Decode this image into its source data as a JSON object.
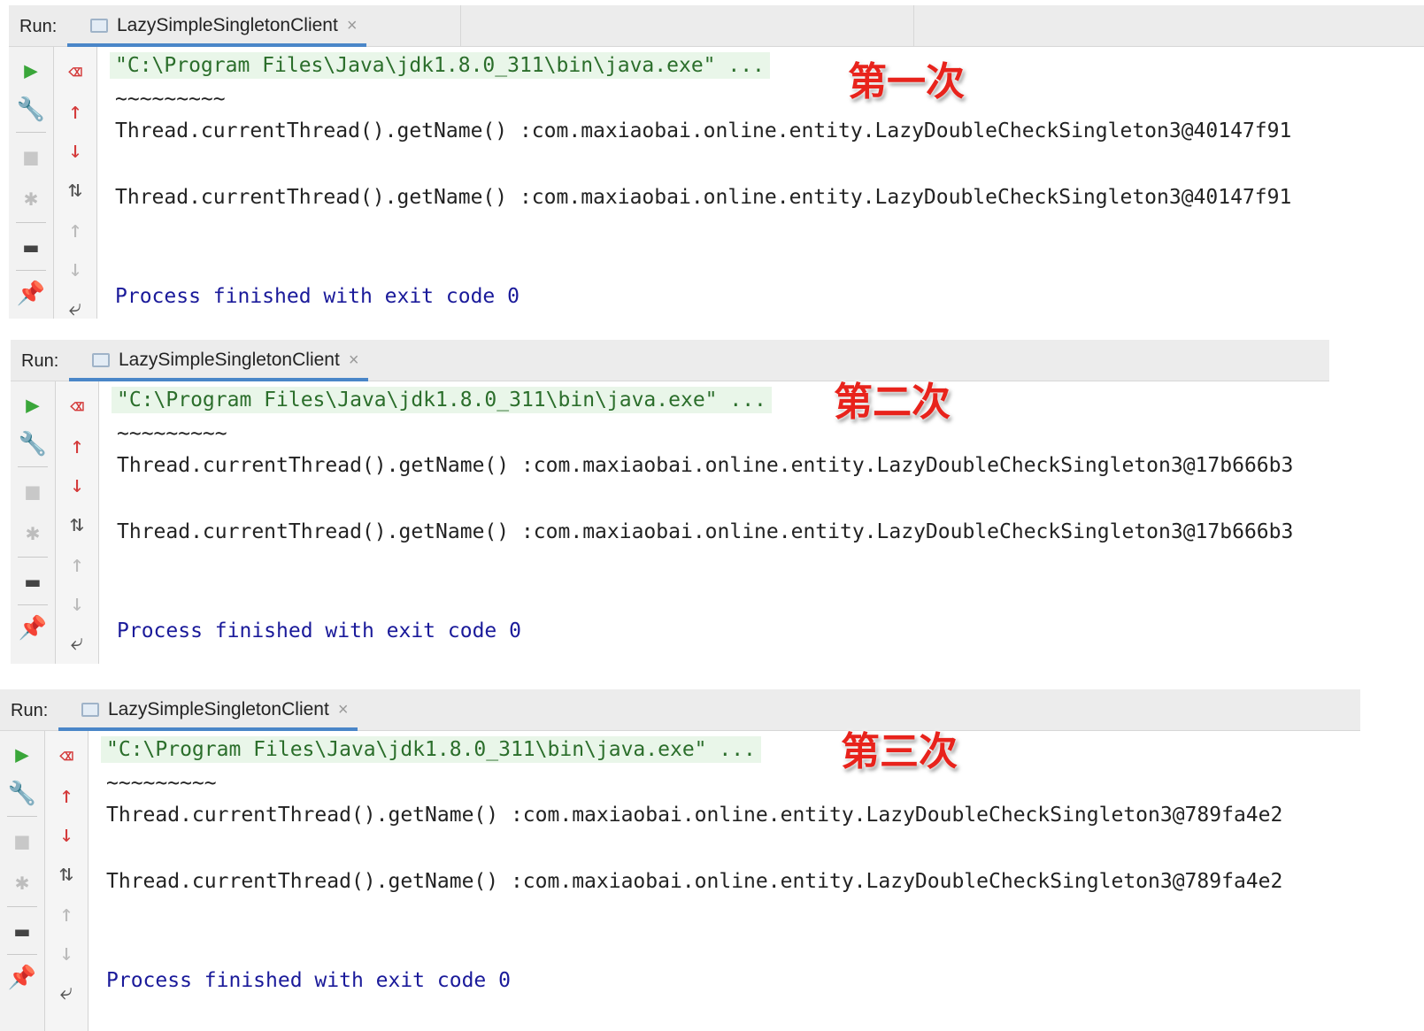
{
  "panels": [
    {
      "run_label": "Run:",
      "tab_title": "LazySimpleSingletonClient",
      "tab_close": "×",
      "command": "\"C:\\Program Files\\Java\\jdk1.8.0_311\\bin\\java.exe\" ...",
      "separator": "~~~~~~~~~",
      "output_1": "Thread.currentThread().getName() :com.maxiaobai.online.entity.LazyDoubleCheckSingleton3@40147f91",
      "output_2": "Thread.currentThread().getName() :com.maxiaobai.online.entity.LazyDoubleCheckSingleton3@40147f91",
      "finished": "Process finished with exit code 0",
      "marker": "第一次"
    },
    {
      "run_label": "Run:",
      "tab_title": "LazySimpleSingletonClient",
      "tab_close": "×",
      "command": "\"C:\\Program Files\\Java\\jdk1.8.0_311\\bin\\java.exe\" ...",
      "separator": "~~~~~~~~~",
      "output_1": "Thread.currentThread().getName() :com.maxiaobai.online.entity.LazyDoubleCheckSingleton3@17b666b3",
      "output_2": "Thread.currentThread().getName() :com.maxiaobai.online.entity.LazyDoubleCheckSingleton3@17b666b3",
      "finished": "Process finished with exit code 0",
      "marker": "第二次"
    },
    {
      "run_label": "Run:",
      "tab_title": "LazySimpleSingletonClient",
      "tab_close": "×",
      "command": "\"C:\\Program Files\\Java\\jdk1.8.0_311\\bin\\java.exe\" ...",
      "separator": "~~~~~~~~~",
      "output_1": "Thread.currentThread().getName() :com.maxiaobai.online.entity.LazyDoubleCheckSingleton3@789fa4e2",
      "output_2": "Thread.currentThread().getName() :com.maxiaobai.online.entity.LazyDoubleCheckSingleton3@789fa4e2",
      "finished": "Process finished with exit code 0",
      "marker": "第三次"
    }
  ],
  "icons": {
    "rerun": "rerun-icon",
    "settings": "wrench-icon",
    "stop": "stop-icon",
    "debug": "debug-icon",
    "layout": "layout-icon",
    "pin": "pin-icon",
    "clear": "clear-icon",
    "up": "arrow-up-icon",
    "down": "arrow-down-icon",
    "sort": "sort-icon",
    "prev": "previous-icon",
    "next": "next-icon",
    "wrap": "soft-wrap-icon"
  },
  "colors": {
    "command_bg": "#e9f6e9",
    "command_text": "#2b6e2b",
    "finished_text": "#1a1a9a",
    "marker_text": "#e8231c",
    "tab_underline": "#4a86c8"
  }
}
